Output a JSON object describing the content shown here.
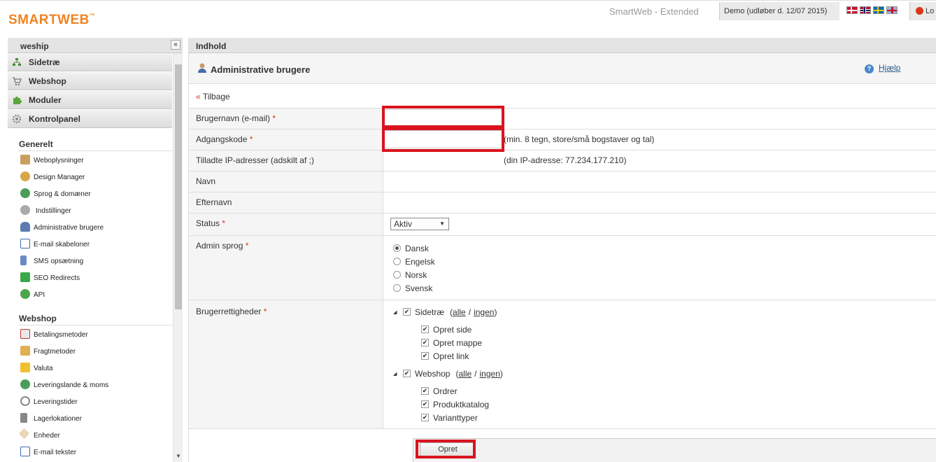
{
  "header": {
    "logo": "SMARTWEB",
    "logo_tm": "™",
    "edition": "SmartWeb - Extended",
    "demo_notice": "Demo (udløber d. 12/07 2015)",
    "flags": [
      "dk-flag",
      "no-flag",
      "se-flag",
      "gb-flag"
    ],
    "logout_label": "Lo"
  },
  "sidebar": {
    "site_name": "weship",
    "collapse_glyph": "«",
    "modules": [
      {
        "label": "Sidetræ",
        "icon": "sitemap-icon"
      },
      {
        "label": "Webshop",
        "icon": "cart-icon"
      },
      {
        "label": "Moduler",
        "icon": "puzzle-icon"
      },
      {
        "label": "Kontrolpanel",
        "icon": "gear-icon"
      }
    ],
    "sections": [
      {
        "title": "Generelt",
        "items": [
          {
            "label": "Weboplysninger",
            "icon": "house-icon"
          },
          {
            "label": "Design Manager",
            "icon": "palette-icon"
          },
          {
            "label": "Sprog & domæner",
            "icon": "globe-icon"
          },
          {
            "label": "Indstillinger",
            "icon": "gear-icon"
          },
          {
            "label": "Administrative brugere",
            "icon": "user-icon"
          },
          {
            "label": "E-mail skabeloner",
            "icon": "email-icon"
          },
          {
            "label": "SMS opsætning",
            "icon": "phone-icon"
          },
          {
            "label": "SEO Redirects",
            "icon": "redirect-icon"
          },
          {
            "label": "API",
            "icon": "sync-icon"
          }
        ]
      },
      {
        "title": "Webshop",
        "items": [
          {
            "label": "Betalingsmetoder",
            "icon": "card-icon"
          },
          {
            "label": "Fragtmetoder",
            "icon": "box-icon"
          },
          {
            "label": "Valuta",
            "icon": "coins-icon"
          },
          {
            "label": "Leveringslande & moms",
            "icon": "globe-icon"
          },
          {
            "label": "Leveringstider",
            "icon": "clock-icon"
          },
          {
            "label": "Lagerlokationer",
            "icon": "building-icon"
          },
          {
            "label": "Enheder",
            "icon": "tag-icon"
          },
          {
            "label": "E-mail tekster",
            "icon": "email-icon"
          }
        ]
      }
    ]
  },
  "content": {
    "header": "Indhold",
    "title": "Administrative brugere",
    "help": "Hjælp",
    "back": {
      "arrow": "«",
      "label": "Tilbage"
    },
    "form": {
      "required_mark": "*",
      "email_label": "Brugernavn (e-mail)",
      "email_value": "",
      "password_label": "Adgangskode",
      "password_value": "",
      "password_hint": "(min. 8 tegn, store/små bogstaver og tal)",
      "ip_label": "Tilladte IP-adresser (adskilt af ;)",
      "ip_hint": "(din IP-adresse: 77.234.177.210)",
      "firstname_label": "Navn",
      "lastname_label": "Efternavn",
      "status_label": "Status",
      "status_value": "Aktiv",
      "language_label": "Admin sprog",
      "languages": [
        {
          "label": "Dansk",
          "checked": true
        },
        {
          "label": "Engelsk",
          "checked": false
        },
        {
          "label": "Norsk",
          "checked": false
        },
        {
          "label": "Svensk",
          "checked": false
        }
      ],
      "rights_label": "Brugerrettigheder",
      "all_label": "alle",
      "none_label": "ingen",
      "separator": "/",
      "rights": [
        {
          "label": "Sidetræ",
          "children": [
            "Opret side",
            "Opret mappe",
            "Opret link"
          ]
        },
        {
          "label": "Webshop",
          "children": [
            "Ordrer",
            "Produktkatalog",
            "Varianttyper"
          ]
        }
      ],
      "submit_label": "Opret"
    }
  }
}
